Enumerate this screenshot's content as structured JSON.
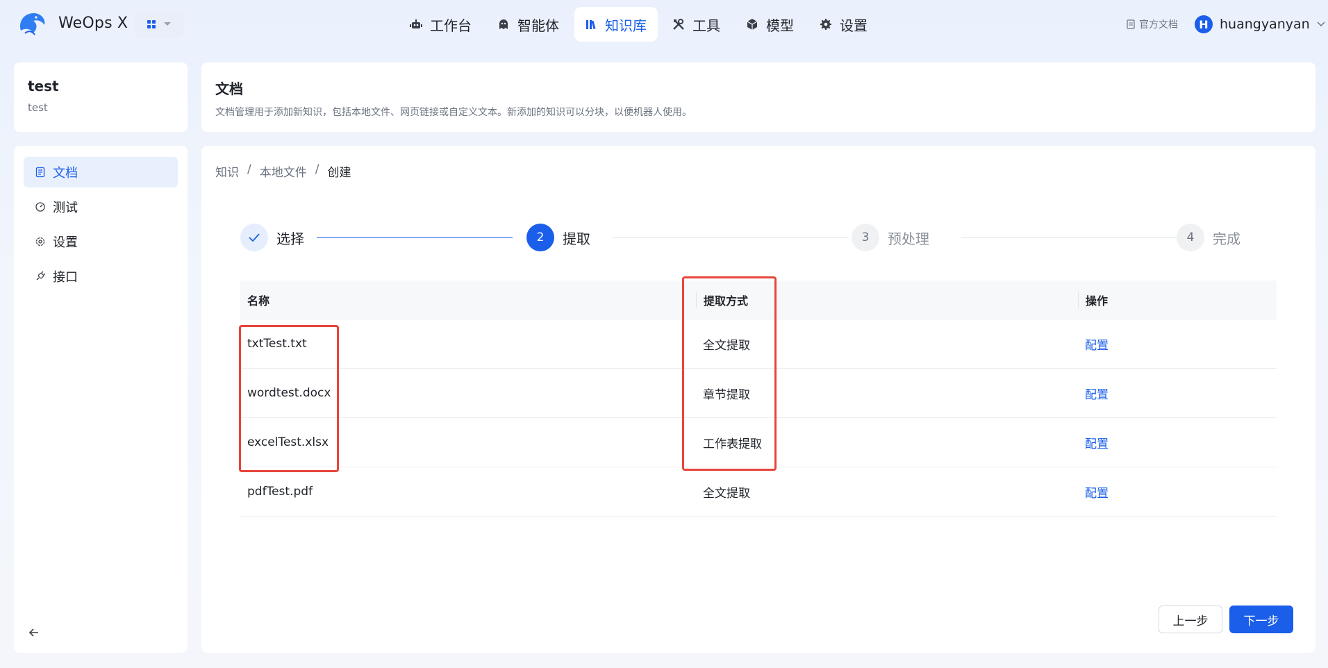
{
  "topbar": {
    "brand": "WeOps X",
    "nav": [
      {
        "label": "工作台",
        "icon": "robot-icon",
        "active": false
      },
      {
        "label": "智能体",
        "icon": "ghost-icon",
        "active": false
      },
      {
        "label": "知识库",
        "icon": "books-icon",
        "active": true
      },
      {
        "label": "工具",
        "icon": "tools-icon",
        "active": false
      },
      {
        "label": "模型",
        "icon": "cube-icon",
        "active": false
      },
      {
        "label": "设置",
        "icon": "gear-icon",
        "active": false
      }
    ],
    "doc_link": "官方文档",
    "user_initial": "H",
    "user_name": "huangyanyan"
  },
  "knowledge_base": {
    "name": "test",
    "description": "test"
  },
  "sidebar": {
    "items": [
      {
        "label": "文档",
        "icon": "document-icon",
        "active": true
      },
      {
        "label": "测试",
        "icon": "gauge-icon",
        "active": false
      },
      {
        "label": "设置",
        "icon": "settings-icon",
        "active": false
      },
      {
        "label": "接口",
        "icon": "plug-icon",
        "active": false
      }
    ]
  },
  "header": {
    "title": "文档",
    "description": "文档管理用于添加新知识，包括本地文件、网页链接或自定义文本。新添加的知识可以分块，以便机器人使用。"
  },
  "breadcrumb": [
    "知识",
    "本地文件",
    "创建"
  ],
  "steps": [
    {
      "num": "1",
      "label": "选择",
      "state": "done"
    },
    {
      "num": "2",
      "label": "提取",
      "state": "current"
    },
    {
      "num": "3",
      "label": "预处理",
      "state": "wait"
    },
    {
      "num": "4",
      "label": "完成",
      "state": "wait"
    }
  ],
  "table": {
    "columns": [
      "名称",
      "提取方式",
      "操作"
    ],
    "rows": [
      {
        "name": "txtTest.txt",
        "method": "全文提取",
        "action": "配置"
      },
      {
        "name": "wordtest.docx",
        "method": "章节提取",
        "action": "配置"
      },
      {
        "name": "excelTest.xlsx",
        "method": "工作表提取",
        "action": "配置"
      },
      {
        "name": "pdfTest.pdf",
        "method": "全文提取",
        "action": "配置"
      }
    ]
  },
  "buttons": {
    "prev": "上一步",
    "next": "下一步"
  },
  "colors": {
    "accent": "#1a5eea",
    "highlight": "#e8443b"
  }
}
